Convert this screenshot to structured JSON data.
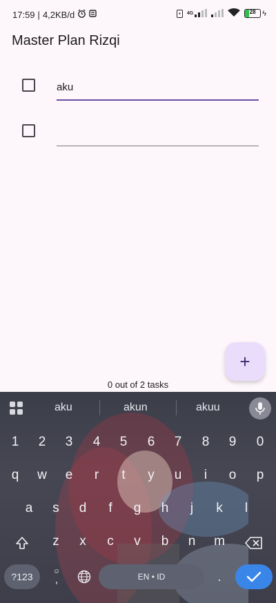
{
  "status_bar": {
    "time": "17:59",
    "net_speed": "4,2KB/d",
    "net_type": "4G",
    "battery": "28",
    "battery_level": 0.28
  },
  "app": {
    "title": "Master Plan Rizqi"
  },
  "tasks": [
    {
      "text": "aku",
      "checked": false
    },
    {
      "text": "",
      "checked": false
    }
  ],
  "fab": {
    "icon": "plus-icon",
    "label": "+"
  },
  "footer": {
    "count_text": "0 out of 2 tasks"
  },
  "keyboard": {
    "suggestions": [
      "aku",
      "akun",
      "akuu"
    ],
    "row_numbers": [
      "1",
      "2",
      "3",
      "4",
      "5",
      "6",
      "7",
      "8",
      "9",
      "0"
    ],
    "row1": [
      "q",
      "w",
      "e",
      "r",
      "t",
      "y",
      "u",
      "i",
      "o",
      "p"
    ],
    "row2": [
      "a",
      "s",
      "d",
      "f",
      "g",
      "h",
      "j",
      "k",
      "l"
    ],
    "row3": [
      "z",
      "x",
      "c",
      "v",
      "b",
      "n",
      "m"
    ],
    "symbols_label": "?123",
    "comma_label": ",",
    "space_label": "EN • ID",
    "period_label": ".",
    "enter_icon": "check-icon",
    "accent_color": "#3A86E8"
  }
}
